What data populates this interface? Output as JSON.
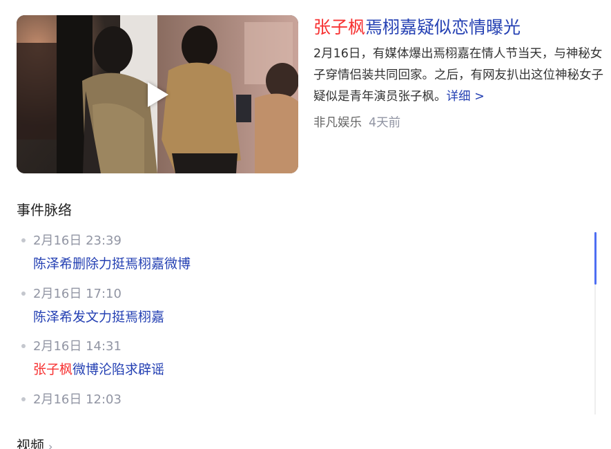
{
  "news": {
    "title_highlight": "张子枫",
    "title_rest": "焉栩嘉疑似恋情曝光",
    "summary": "2月16日，有媒体爆出焉栩嘉在情人节当天，与神秘女子穿情侣装共同回家。之后，有网友扒出这位神秘女子疑似是青年演员张子枫。",
    "more_label": "详细 >",
    "source": "非凡娱乐",
    "time": "4天前",
    "thumbnail_icon": "play-icon"
  },
  "timeline": {
    "title": "事件脉络",
    "items": [
      {
        "time": "2月16日 23:39",
        "title_highlight": "",
        "title_rest": "陈泽希删除力挺焉栩嘉微博"
      },
      {
        "time": "2月16日 17:10",
        "title_highlight": "",
        "title_rest": "陈泽希发文力挺焉栩嘉"
      },
      {
        "time": "2月16日 14:31",
        "title_highlight": "张子枫",
        "title_rest": "微博沦陷求辟谣"
      },
      {
        "time": "2月16日 12:03",
        "title_highlight": "",
        "title_rest": ""
      }
    ]
  },
  "video_section": {
    "title": "视频",
    "chevron": "›"
  },
  "colors": {
    "link": "#2440b3",
    "highlight": "#f73131",
    "muted": "#9195a3",
    "scroll_accent": "#4e6ef2"
  }
}
